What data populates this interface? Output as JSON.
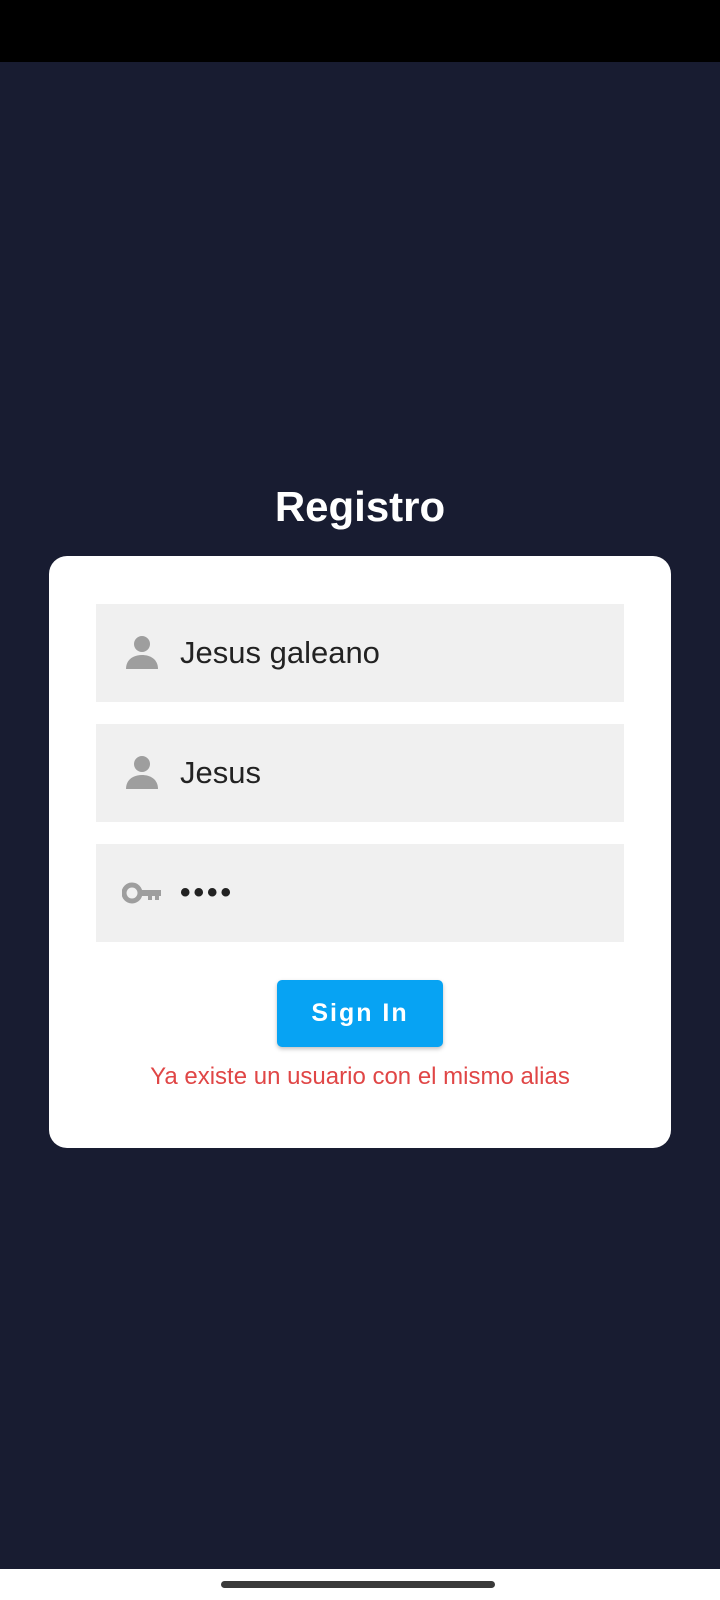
{
  "screen": {
    "title": "Registro"
  },
  "form": {
    "name_field": {
      "value": "Jesus galeano",
      "icon": "person-icon"
    },
    "alias_field": {
      "value": "Jesus",
      "icon": "person-icon"
    },
    "password_field": {
      "value": "••••",
      "icon": "key-icon"
    },
    "submit_label": "Sign In",
    "error_message": "Ya existe un usuario con el mismo alias"
  },
  "colors": {
    "background": "#181c31",
    "button": "#07a3f3",
    "error": "#e04646",
    "field_background": "#f0f0f0",
    "icon": "#9e9e9e"
  }
}
